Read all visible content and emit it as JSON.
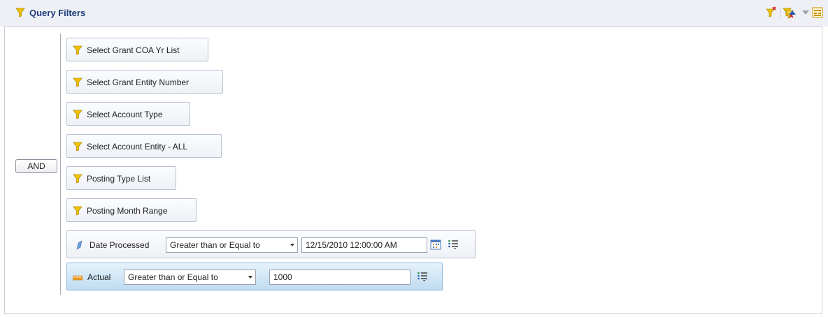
{
  "header": {
    "title": "Query Filters",
    "icons": [
      "funnel-icon",
      "add-filter-icon",
      "remove-filter-icon",
      "move-up-icon",
      "move-down-icon",
      "panel-options-icon"
    ]
  },
  "group": {
    "operator": "AND"
  },
  "filters": [
    {
      "label": "Select Grant COA Yr List",
      "icon": "funnel-icon"
    },
    {
      "label": "Select Grant Entity Number",
      "icon": "funnel-icon"
    },
    {
      "label": "Select Account Type",
      "icon": "funnel-icon"
    },
    {
      "label": "Select Account Entity - ALL",
      "icon": "funnel-icon"
    },
    {
      "label": "Posting Type List",
      "icon": "funnel-icon"
    },
    {
      "label": "Posting Month Range",
      "icon": "funnel-icon"
    }
  ],
  "conditions": [
    {
      "field": "Date Processed",
      "icon": "dimension-icon",
      "operator": "Greater than or Equal to",
      "value": "12/15/2010 12:00:00 AM"
    },
    {
      "field": "Actual",
      "icon": "measure-icon",
      "operator": "Greater than or Equal to",
      "value": "1000"
    }
  ],
  "colors": {
    "header_bg": "#eef0f5",
    "title": "#1e3a7a",
    "funnel": "#f2c200",
    "active_row": "#bfdcf2"
  }
}
